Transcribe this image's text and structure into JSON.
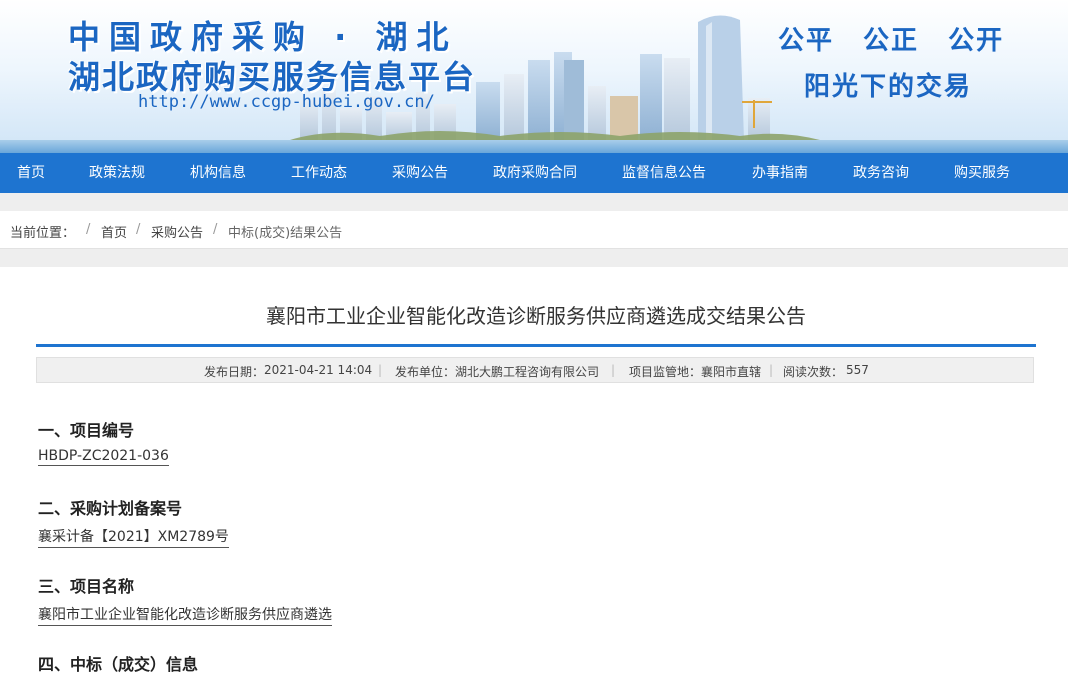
{
  "banner": {
    "line1": "中国政府采购 · 湖北",
    "line2": "湖北政府购买服务信息平台",
    "url": "http://www.ccgp-hubei.gov.cn/",
    "slogan_line1": "公平 公正 公开",
    "slogan_line2": "阳光下的交易"
  },
  "nav": {
    "items": [
      "首页",
      "政策法规",
      "机构信息",
      "工作动态",
      "采购公告",
      "政府采购合同",
      "监督信息公告",
      "办事指南",
      "政务咨询",
      "购买服务"
    ]
  },
  "breadcrumb": {
    "label": "当前位置：",
    "sep": "/",
    "items": [
      "首页",
      "采购公告",
      "中标(成交)结果公告"
    ]
  },
  "article": {
    "title": "襄阳市工业企业智能化改造诊断服务供应商遴选成交结果公告",
    "meta": {
      "date_label": "发布日期：",
      "date": "2021-04-21 14:04",
      "unit_label": "发布单位：",
      "unit": "湖北大鹏工程咨询有限公司",
      "supervisor_label": "项目监管地：",
      "supervisor": "襄阳市直辖",
      "views_label": "阅读次数：",
      "views": "557",
      "sep": "|"
    },
    "sections": [
      {
        "heading": "一、项目编号",
        "value": "HBDP-ZC2021-036"
      },
      {
        "heading": "二、采购计划备案号",
        "value": "襄采计备【2021】XM2789号"
      },
      {
        "heading": "三、项目名称",
        "value": "襄阳市工业企业智能化改造诊断服务供应商遴选"
      },
      {
        "heading": "四、中标（成交）信息",
        "value": ""
      }
    ]
  },
  "colors": {
    "brand_blue": "#1b66c2",
    "nav_blue": "#1e74d0"
  }
}
